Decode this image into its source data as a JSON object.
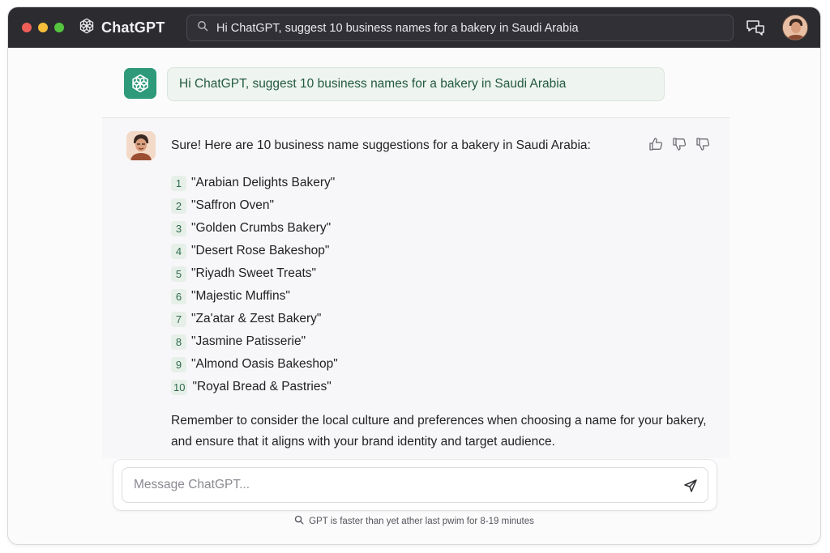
{
  "app": {
    "name": "ChatGPT"
  },
  "search": {
    "query": "Hi ChatGPT, suggest 10 business names for a bakery in Saudi Arabia"
  },
  "prompt": {
    "text": "Hi ChatGPT, suggest 10 business names for a bakery in Saudi Arabia"
  },
  "response": {
    "intro": "Sure! Here are 10 business name suggestions for a bakery in Saudi Arabia:",
    "items": [
      {
        "num": "1",
        "text": "\"Arabian Delights Bakery\""
      },
      {
        "num": "2",
        "text": "\"Saffron Oven\""
      },
      {
        "num": "3",
        "text": "\"Golden Crumbs Bakery\""
      },
      {
        "num": "4",
        "text": "\"Desert Rose Bakeshop\""
      },
      {
        "num": "5",
        "text": "\"Riyadh Sweet Treats\""
      },
      {
        "num": "6",
        "text": "\"Majestic Muffins\""
      },
      {
        "num": "7",
        "text": "\"Za'atar & Zest Bakery\""
      },
      {
        "num": "8",
        "text": "\"Jasmine Patisserie\""
      },
      {
        "num": "9",
        "text": "\"Almond Oasis Bakeshop\""
      },
      {
        "num": "10",
        "text": "\"Royal Bread & Pastries\""
      }
    ],
    "closing": "Remember to consider the local culture and preferences when choosing a name for your bakery, and ensure that it aligns with your brand identity and target audience."
  },
  "composer": {
    "placeholder": "Message ChatGPT..."
  },
  "footer": {
    "note": "GPT is faster than yet ather last pwim for 8-19 minutes"
  },
  "icons": {
    "brand": "openai-logo-icon",
    "search": "search-icon",
    "toolbar": "chat-bubbles-icon",
    "feedback": [
      "thumbs-up-icon",
      "thumbs-down-icon",
      "thumbs-down-icon"
    ],
    "send": "send-icon",
    "footer": "search-icon"
  },
  "colors": {
    "titlebar": "#2b2b30",
    "accent": "#2e9a7a",
    "prompt_bg": "#eef4f0",
    "prompt_text": "#235a40"
  }
}
